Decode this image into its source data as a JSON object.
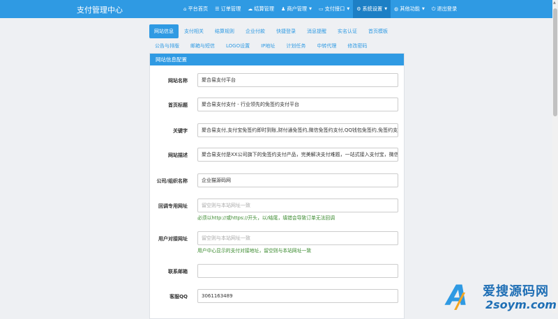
{
  "navbar": {
    "brand": "支付管理中心",
    "items": [
      {
        "label": "平台首页",
        "icon": "home-icon",
        "glyph": "⌂",
        "caret": ""
      },
      {
        "label": "订单管理",
        "icon": "list-icon",
        "glyph": "☰",
        "caret": ""
      },
      {
        "label": "结算管理",
        "icon": "cloud-icon",
        "glyph": "☁",
        "caret": ""
      },
      {
        "label": "商户管理",
        "icon": "user-icon",
        "glyph": "♟",
        "caret": "▼"
      },
      {
        "label": "支付接口",
        "icon": "wallet-icon",
        "glyph": "▭",
        "caret": "▼"
      },
      {
        "label": "系统设置",
        "icon": "gear-icon",
        "glyph": "⚙",
        "caret": "▼"
      },
      {
        "label": "其他功能",
        "icon": "globe-icon",
        "glyph": "◍",
        "caret": "▼"
      },
      {
        "label": "退出登录",
        "icon": "power-icon",
        "glyph": "⏻",
        "caret": ""
      }
    ]
  },
  "tabs": {
    "row1": [
      "网站信息",
      "支付相关",
      "结算规则",
      "企业付款",
      "快捷登录",
      "消息提醒",
      "实名认证",
      "首页模板"
    ],
    "row2": [
      "公告与排版",
      "邮箱与短信",
      "LOGO设置",
      "IP地址",
      "计划任务",
      "中转代理",
      "修改密码"
    ]
  },
  "panel": {
    "title": "网站信息配置",
    "fields": [
      {
        "label": "网站名称",
        "value": "聚合易支付平台",
        "placeholder": "",
        "help": ""
      },
      {
        "label": "首页标题",
        "value": "聚合易支付支付 - 行业领先的免签约支付平台",
        "placeholder": "",
        "help": ""
      },
      {
        "label": "关键字",
        "value": "聚合易支付,支付宝免签约即时到账,财付通免签约,微信免签约支付,QQ钱包免签约,免签约支付",
        "placeholder": "",
        "help": ""
      },
      {
        "label": "网站描述",
        "value": "聚合易支付是XX公司旗下的免签约支付产品，完美解决支付难题，一站式接入支付宝，微信，财付通",
        "placeholder": "",
        "help": ""
      },
      {
        "label": "公司/组织名称",
        "value": "企业猫源码网",
        "placeholder": "",
        "help": ""
      },
      {
        "label": "回调专用网址",
        "value": "",
        "placeholder": "留空则与本站网址一致",
        "help": "必须以http://或https://开头，以/结尾，填错会导致订单无法回调"
      },
      {
        "label": "用户对接网址",
        "value": "",
        "placeholder": "留空则与本站网址一致",
        "help": "用户中心显示的支付对接地址，留空则与本站网址一致"
      },
      {
        "label": "联系邮箱",
        "value": "",
        "placeholder": "",
        "help": ""
      },
      {
        "label": "客服QQ",
        "value": "3061163489",
        "placeholder": "",
        "help": ""
      }
    ]
  },
  "watermark": {
    "cn": "爱搜源码网",
    "en": "2soym.com"
  }
}
